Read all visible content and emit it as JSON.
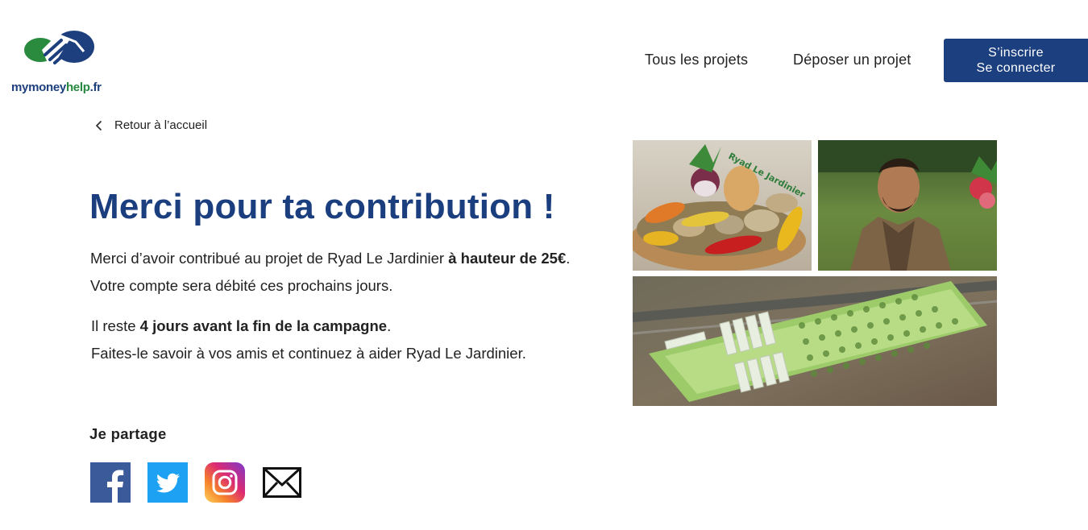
{
  "header": {
    "logo": {
      "icon": "handshake-icon",
      "text_part1": "mymoney",
      "text_part2": "help",
      "text_part3": ".fr",
      "colors": {
        "blue": "#1d3f7e",
        "green": "#27883f"
      }
    },
    "nav": {
      "all_projects": "Tous les projets",
      "submit_project": "Déposer un projet"
    },
    "auth": {
      "signup": "S’inscrire",
      "login": "Se connecter",
      "color": "#1c3f7f"
    }
  },
  "back_link": {
    "icon": "chevron-left-icon",
    "label": "Retour à l’accueil"
  },
  "main": {
    "title": "Merci pour ta contribution !",
    "title_color": "#1b3e7e",
    "contribution": {
      "line1_prefix": "Merci d’avoir contribué au projet de Ryad Le Jardinier ",
      "line1_bold": "à hauteur de 25€",
      "line1_suffix": ".",
      "line2": "Votre compte sera débité ces prochains jours."
    },
    "campaign": {
      "line1_prefix": "Il reste ",
      "line1_bold": "4 jours avant la fin de la campagne",
      "line1_suffix": ".",
      "line2": "Faites-le savoir à vos amis et continuez à aider Ryad Le Jardinier."
    }
  },
  "share": {
    "title": "Je  partage",
    "icons": [
      "facebook-icon",
      "twitter-icon",
      "instagram-icon",
      "email-icon"
    ]
  },
  "collage": {
    "watermark": "Ryad Le Jardinier",
    "images": [
      "vegetables-basket-photo",
      "gardener-portrait-photo",
      "aerial-farm-photo"
    ]
  }
}
